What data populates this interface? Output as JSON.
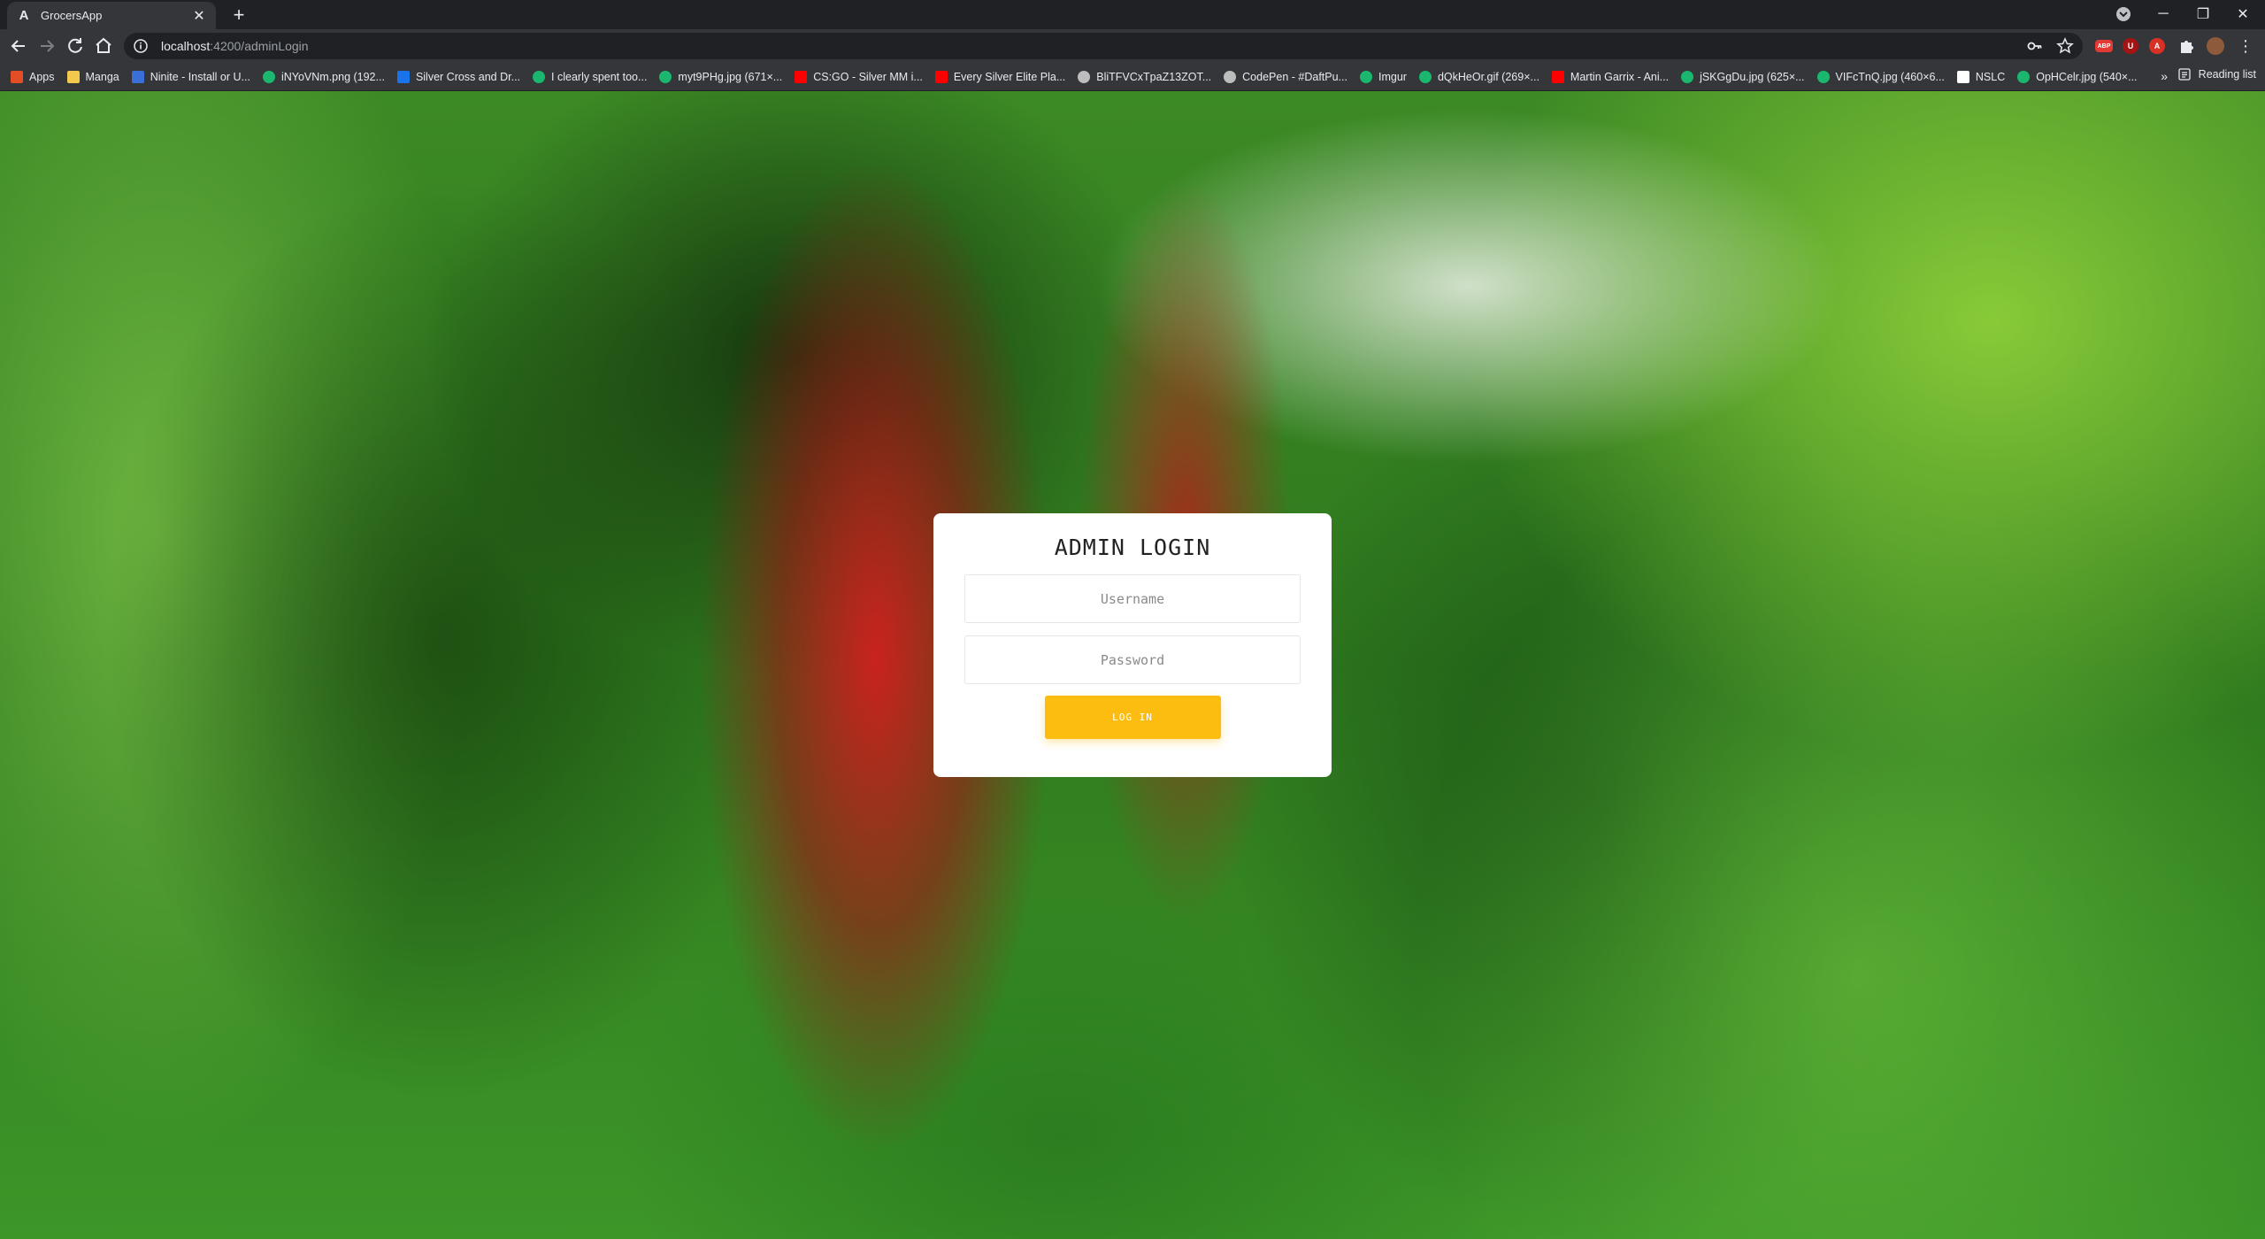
{
  "browser": {
    "tab": {
      "title": "GrocersApp",
      "favicon_letter": "A"
    },
    "url": {
      "host": "localhost",
      "path": ":4200/adminLogin"
    },
    "bookmarks": [
      {
        "label": "Apps",
        "icon": "apps-grid-icon",
        "color": "#e44d26"
      },
      {
        "label": "Manga",
        "icon": "folder-icon",
        "color": "#f2c94c"
      },
      {
        "label": "Ninite - Install or U...",
        "icon": "ninite-icon",
        "color": "#3b6fd8"
      },
      {
        "label": "iNYoVNm.png (192...",
        "icon": "imgur-icon",
        "color": "#1bb76e"
      },
      {
        "label": "Silver Cross and Dr...",
        "icon": "square-blue-icon",
        "color": "#1a73e8"
      },
      {
        "label": "I clearly spent too...",
        "icon": "imgur-icon",
        "color": "#1bb76e"
      },
      {
        "label": "myt9PHg.jpg (671×...",
        "icon": "imgur-icon",
        "color": "#1bb76e"
      },
      {
        "label": "CS:GO - Silver MM i...",
        "icon": "youtube-icon",
        "color": "#ff0000"
      },
      {
        "label": "Every Silver Elite Pla...",
        "icon": "youtube-icon",
        "color": "#ff0000"
      },
      {
        "label": "BliTFVCxTpaZ13ZOT...",
        "icon": "globe-icon",
        "color": "#bdbdbd"
      },
      {
        "label": "CodePen - #DaftPu...",
        "icon": "codepen-icon",
        "color": "#bdbdbd"
      },
      {
        "label": "Imgur",
        "icon": "imgur-icon",
        "color": "#1bb76e"
      },
      {
        "label": "dQkHeOr.gif (269×...",
        "icon": "imgur-icon",
        "color": "#1bb76e"
      },
      {
        "label": "Martin Garrix - Ani...",
        "icon": "youtube-icon",
        "color": "#ff0000"
      },
      {
        "label": "jSKGgDu.jpg (625×...",
        "icon": "imgur-icon",
        "color": "#1bb76e"
      },
      {
        "label": "VIFcTnQ.jpg (460×6...",
        "icon": "imgur-icon",
        "color": "#1bb76e"
      },
      {
        "label": "NSLC",
        "icon": "square-white-icon",
        "color": "#ffffff"
      },
      {
        "label": "OpHCelr.jpg (540×...",
        "icon": "imgur-icon",
        "color": "#1bb76e"
      }
    ],
    "more_bookmarks": "»",
    "reading_list": "Reading list"
  },
  "login": {
    "title": "ADMIN LOGIN",
    "username_placeholder": "Username",
    "password_placeholder": "Password",
    "button_label": "LOG IN",
    "button_color": "#fdbd10"
  }
}
